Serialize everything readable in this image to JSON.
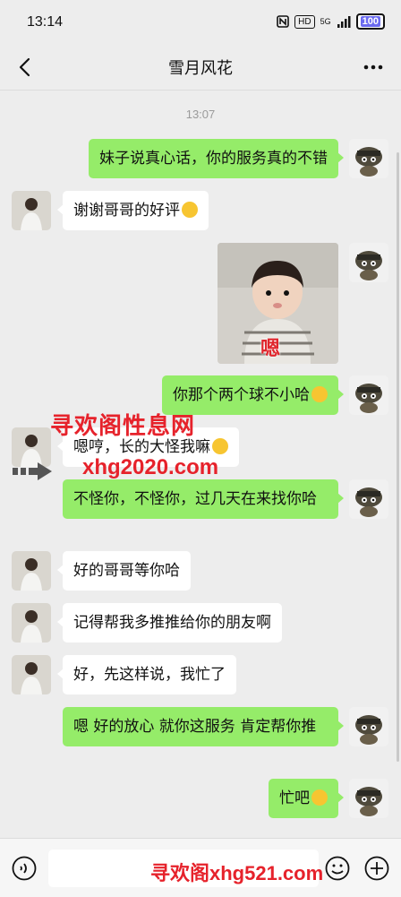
{
  "status_bar": {
    "time": "13:14",
    "nfc_icon": "nfc-icon",
    "hd_label": "HD",
    "signal_label": "5G",
    "battery_label": "100"
  },
  "nav": {
    "back_icon": "chevron-left-icon",
    "title": "雪月风花",
    "more_icon": "more-dots-icon"
  },
  "chat": {
    "timestamp": "13:07",
    "messages": [
      {
        "side": "out",
        "text": "妹子说真心话，你的服务真的不错"
      },
      {
        "side": "in",
        "text": "谢谢哥哥的好评"
      },
      {
        "side": "out",
        "type": "sticker",
        "text": "嗯"
      },
      {
        "side": "out",
        "text": "你那个两个球不小哈"
      },
      {
        "side": "in",
        "text": "嗯哼，长的大怪我嘛"
      },
      {
        "side": "out",
        "text": "不怪你，不怪你，过几天在来找你哈"
      },
      {
        "side": "in",
        "text": "好的哥哥等你哈"
      },
      {
        "side": "in",
        "text": "记得帮我多推推给你的朋友啊"
      },
      {
        "side": "in",
        "text": "好，先这样说，我忙了"
      },
      {
        "side": "out",
        "text": "嗯 好的放心 就你这服务 肯定帮你推"
      },
      {
        "side": "out",
        "text": "忙吧"
      }
    ]
  },
  "watermarks": {
    "line1": "寻欢阁性息网",
    "line2": "xhg2020.com",
    "line3": "寻欢阁xhg521.com"
  },
  "input_bar": {
    "voice_icon": "voice-icon",
    "emoji_icon": "emoji-icon",
    "plus_icon": "plus-circle-icon"
  },
  "colors": {
    "outgoing_bubble": "#95ec69",
    "incoming_bubble": "#ffffff",
    "background": "#ededed",
    "watermark": "#e6222b"
  }
}
